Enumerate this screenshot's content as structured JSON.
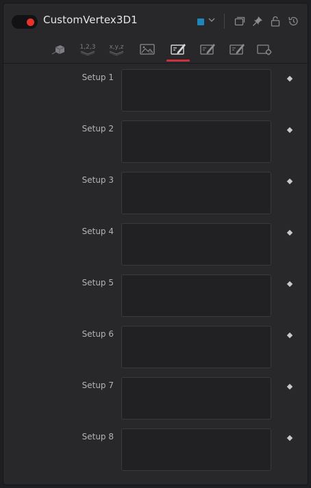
{
  "header": {
    "title": "CustomVertex3D1",
    "enabled": true,
    "accent_color": "#1e86b8",
    "toggle_color": "#e8322a",
    "icons": [
      "chevron-down-icon",
      "versions-icon",
      "pin-icon",
      "lock-icon",
      "reset-icon"
    ]
  },
  "tabs": [
    {
      "name": "tab-controls",
      "icon": "cube-icon",
      "label": ""
    },
    {
      "name": "tab-numbers",
      "icon": "numbers-icon",
      "label": "1,2,3"
    },
    {
      "name": "tab-xyz",
      "icon": "xyz-icon",
      "label": "x,y,z"
    },
    {
      "name": "tab-image",
      "icon": "image-icon",
      "label": ""
    },
    {
      "name": "tab-setup",
      "icon": "script-icon",
      "label": "",
      "active": true
    },
    {
      "name": "tab-intermediate",
      "icon": "script-icon",
      "label": ""
    },
    {
      "name": "tab-custom",
      "icon": "script-icon",
      "label": ""
    },
    {
      "name": "tab-settings",
      "icon": "settings-icon",
      "label": ""
    }
  ],
  "active_tab_color": "#d1303a",
  "setups": [
    {
      "label": "Setup 1",
      "value": ""
    },
    {
      "label": "Setup 2",
      "value": ""
    },
    {
      "label": "Setup 3",
      "value": ""
    },
    {
      "label": "Setup 4",
      "value": ""
    },
    {
      "label": "Setup 5",
      "value": ""
    },
    {
      "label": "Setup 6",
      "value": ""
    },
    {
      "label": "Setup 7",
      "value": ""
    },
    {
      "label": "Setup 8",
      "value": ""
    }
  ]
}
